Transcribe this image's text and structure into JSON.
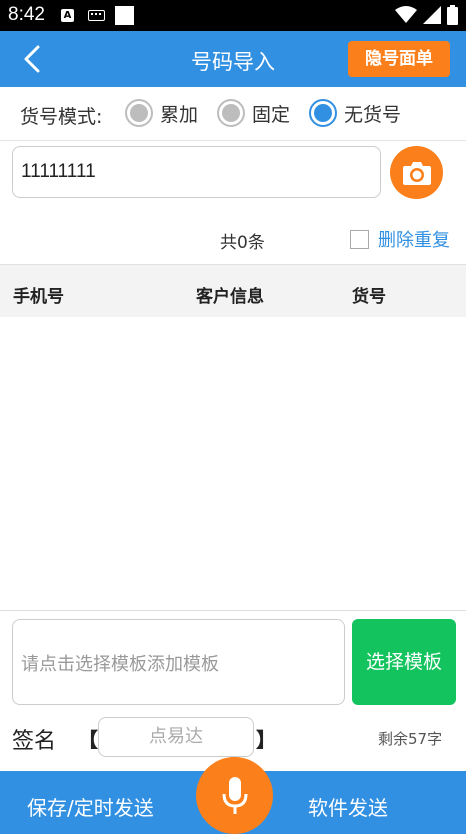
{
  "status_bar": {
    "time": "8:42",
    "notification_badge": "A",
    "icons": [
      "keyboard-icon",
      "square-icon",
      "wifi-icon",
      "signal-icon",
      "battery-icon"
    ]
  },
  "app_bar": {
    "title": "号码导入",
    "back_icon": "chevron-left-icon",
    "privacy_button": "隐号面单"
  },
  "mode": {
    "label": "货号模式:",
    "options": [
      {
        "label": "累加",
        "checked": false
      },
      {
        "label": "固定",
        "checked": false
      },
      {
        "label": "无货号",
        "checked": true
      }
    ]
  },
  "number_input": {
    "value": "11111111",
    "camera_icon": "camera-icon"
  },
  "summary": {
    "count_text": "共0条",
    "dedupe_label": "删除重复",
    "dedupe_checked": false
  },
  "table": {
    "columns": [
      "手机号",
      "客户信息",
      "货号"
    ],
    "rows": []
  },
  "template": {
    "placeholder": "请点击选择模板添加模板",
    "button": "选择模板"
  },
  "signature": {
    "label": "签名",
    "bracket_open": "【",
    "bracket_close": "】",
    "value": "点易达",
    "remaining": "剩余57字"
  },
  "bottom_bar": {
    "save_button": "保存/定时发送",
    "send_button": "软件发送",
    "mic_icon": "microphone-icon"
  },
  "colors": {
    "primary": "#3290e2",
    "accent": "#fb7f1a",
    "green": "#13c35e"
  }
}
